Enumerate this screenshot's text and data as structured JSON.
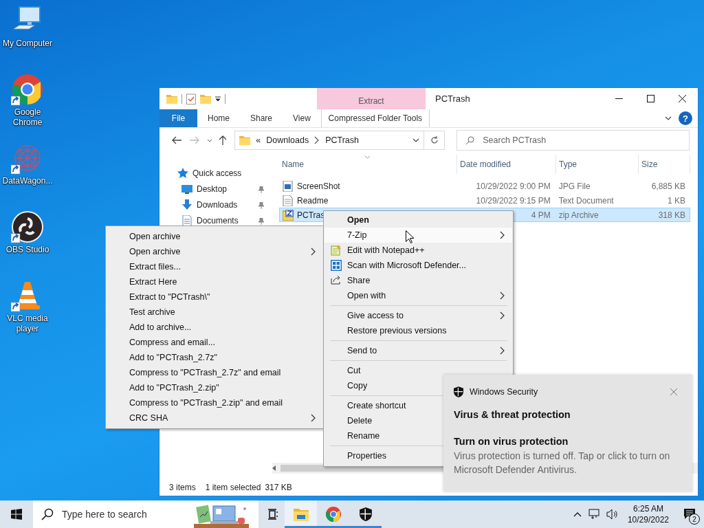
{
  "desktop_icons": [
    {
      "label": "My Computer",
      "kind": "computer",
      "shortcut": false
    },
    {
      "label": "Google Chrome",
      "kind": "chrome",
      "shortcut": true
    },
    {
      "label": "DataWagon...",
      "kind": "pattern",
      "shortcut": true
    },
    {
      "label": "OBS Studio",
      "kind": "obs",
      "shortcut": true
    },
    {
      "label": "VLC media player",
      "kind": "cone",
      "shortcut": true
    }
  ],
  "explorer": {
    "title": "PCTrash",
    "context_tab_header": "Extract",
    "ribbon_tabs": [
      {
        "label": "File",
        "kind": "file"
      },
      {
        "label": "Home",
        "kind": "plain"
      },
      {
        "label": "Share",
        "kind": "plain"
      },
      {
        "label": "View",
        "kind": "plain"
      },
      {
        "label": "Compressed Folder Tools",
        "kind": "contextual"
      }
    ],
    "help": "?",
    "address": {
      "overflow": "«",
      "crumbs": [
        "Downloads",
        "PCTrash"
      ]
    },
    "search": {
      "placeholder": "Search PCTrash"
    },
    "nav_items": [
      {
        "label": "Quick access",
        "kind": "star",
        "pinned": false
      },
      {
        "label": "Desktop",
        "kind": "desktop",
        "pinned": true
      },
      {
        "label": "Downloads",
        "kind": "download",
        "pinned": true
      },
      {
        "label": "Documents",
        "kind": "document",
        "pinned": true
      }
    ],
    "columns": [
      "Name",
      "Date modified",
      "Type",
      "Size"
    ],
    "rows": [
      {
        "kind": "image",
        "name": "ScreenShot",
        "date": "10/29/2022 9:00 PM",
        "type": "JPG File",
        "size": "6,885 KB",
        "selected": false
      },
      {
        "kind": "text",
        "name": "Readme",
        "date": "10/29/2022 9:15 PM",
        "type": "Text Document",
        "size": "1 KB",
        "selected": false
      },
      {
        "kind": "archive",
        "name": "PCTras",
        "date": "4 PM",
        "type": "zip Archive",
        "size": "318 KB",
        "selected": true
      }
    ],
    "status": {
      "count": "3 items",
      "selection": "1 item selected",
      "selection_size": "317 KB"
    }
  },
  "submenu": {
    "items": [
      {
        "label": "Open archive",
        "submenu": false
      },
      {
        "label": "Open archive",
        "submenu": true
      },
      {
        "label": "Extract files...",
        "submenu": false
      },
      {
        "label": "Extract Here",
        "submenu": false
      },
      {
        "label": "Extract to \"PCTrash\\\"",
        "submenu": false
      },
      {
        "label": "Test archive",
        "submenu": false
      },
      {
        "label": "Add to archive...",
        "submenu": false
      },
      {
        "label": "Compress and email...",
        "submenu": false
      },
      {
        "label": "Add to \"PCTrash_2.7z\"",
        "submenu": false
      },
      {
        "label": "Compress to \"PCTrash_2.7z\" and email",
        "submenu": false
      },
      {
        "label": "Add to \"PCTrash_2.zip\"",
        "submenu": false
      },
      {
        "label": "Compress to \"PCTrash_2.zip\" and email",
        "submenu": false
      },
      {
        "label": "CRC SHA",
        "submenu": true
      }
    ]
  },
  "context_menu": {
    "groups": [
      [
        {
          "label": "Open",
          "kind": "plain",
          "default": true,
          "submenu": false,
          "selected": false
        },
        {
          "label": "7-Zip",
          "kind": "plain",
          "default": false,
          "submenu": true,
          "selected": true
        },
        {
          "label": "Edit with Notepad++",
          "kind": "editor",
          "default": false,
          "submenu": false,
          "selected": false
        },
        {
          "label": "Scan with Microsoft Defender...",
          "kind": "scanner",
          "default": false,
          "submenu": false,
          "selected": false
        },
        {
          "label": "Share",
          "kind": "share",
          "default": false,
          "submenu": false,
          "selected": false
        },
        {
          "label": "Open with",
          "kind": "plain",
          "default": false,
          "submenu": true,
          "selected": false
        }
      ],
      [
        {
          "label": "Give access to",
          "kind": "plain",
          "default": false,
          "submenu": true,
          "selected": false
        },
        {
          "label": "Restore previous versions",
          "kind": "plain",
          "default": false,
          "submenu": false,
          "selected": false
        }
      ],
      [
        {
          "label": "Send to",
          "kind": "plain",
          "default": false,
          "submenu": true,
          "selected": false
        }
      ],
      [
        {
          "label": "Cut",
          "kind": "plain",
          "default": false,
          "submenu": false,
          "selected": false
        },
        {
          "label": "Copy",
          "kind": "plain",
          "default": false,
          "submenu": false,
          "selected": false
        }
      ],
      [
        {
          "label": "Create shortcut",
          "kind": "plain",
          "default": false,
          "submenu": false,
          "selected": false
        },
        {
          "label": "Delete",
          "kind": "plain",
          "default": false,
          "submenu": false,
          "selected": false
        },
        {
          "label": "Rename",
          "kind": "plain",
          "default": false,
          "submenu": false,
          "selected": false
        }
      ],
      [
        {
          "label": "Properties",
          "kind": "plain",
          "default": false,
          "submenu": false,
          "selected": false
        }
      ]
    ]
  },
  "toast": {
    "app": "Windows Security",
    "title": "Virus & threat protection",
    "heading": "Turn on virus protection",
    "body": "Virus protection is turned off. Tap or click to turn on Microsoft Defender Antivirus."
  },
  "taskbar": {
    "search": {
      "placeholder": "Type here to search"
    },
    "apps": [
      {
        "kind": "task-view",
        "running": false,
        "active": false
      },
      {
        "kind": "explorer",
        "running": true,
        "active": true
      },
      {
        "kind": "chrome",
        "running": true,
        "active": false
      },
      {
        "kind": "security",
        "running": true,
        "active": false
      }
    ],
    "clock": {
      "time": "6:25 AM",
      "date": "10/29/2022"
    },
    "notifications": "2"
  }
}
